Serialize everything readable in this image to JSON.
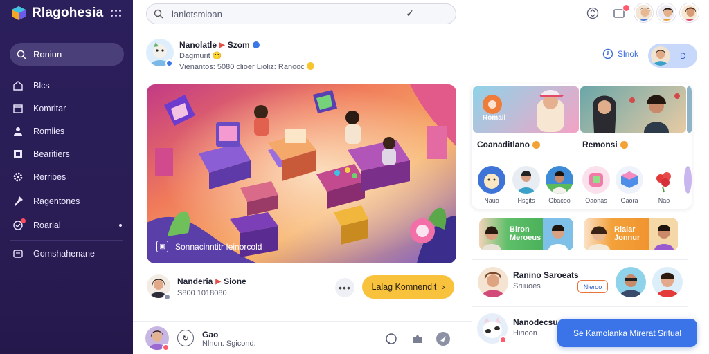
{
  "app": {
    "name": "Rlagohesia"
  },
  "sidebar": {
    "search_label": "Roniun",
    "items": [
      {
        "label": "Blcs",
        "icon": "home-icon"
      },
      {
        "label": "Komritar",
        "icon": "calendar-icon"
      },
      {
        "label": "Romiies",
        "icon": "person-icon"
      },
      {
        "label": "Bearitiers",
        "icon": "bookmark-icon"
      },
      {
        "label": "Rerribes",
        "icon": "gear-icon"
      },
      {
        "label": "Ragentones",
        "icon": "pin-icon"
      },
      {
        "label": "Roarial",
        "icon": "badge-icon"
      },
      {
        "label": "Gomshahenane",
        "icon": "document-icon"
      }
    ]
  },
  "topbar": {
    "search_placeholder": "lanlotsmioan"
  },
  "post": {
    "author": "Nanolatle",
    "author_tag": "Szom",
    "subtitle": "Dagmurit",
    "meta": "Vienantos: 5080 clioer Lioliz: Ranooc",
    "follow_label": "Slnok",
    "follow_pill_text": "D",
    "caption": "Sonnacinntitr Ieinorcold"
  },
  "post2": {
    "author": "Nanderia",
    "author_tag": "Sione",
    "subtitle": "S800 1018080",
    "cta_label": "Lalag Komnendit",
    "more_label": "•••"
  },
  "bottombar": {
    "title": "Gao",
    "subtitle": "Nlnon. Sgicond."
  },
  "right_panel": {
    "card_titles": [
      "Romail"
    ],
    "labels": [
      "Coanaditlano",
      "Remonsi"
    ],
    "circles": [
      "Nauo",
      "Hsgits",
      "Gbacoo",
      "Oaonas",
      "Gaora",
      "Nao"
    ],
    "banners": [
      {
        "text": "Biron\nMeroeus"
      },
      {
        "text": "Rlalar\nJonnur"
      }
    ],
    "rows": [
      {
        "name": "Ranino Saroeats",
        "sub": "Sriiuoes",
        "tag": "Nleroo"
      },
      {
        "name": "Nanodecsue",
        "sub": "Hirioon"
      }
    ],
    "toast": "Se Kamolanka Mirerat Sritual"
  },
  "colors": {
    "sidebar": "#2b1f5c",
    "accent_blue": "#3a74e8",
    "cta_yellow": "#f9c23c",
    "alert_red": "#ff5a6e"
  }
}
